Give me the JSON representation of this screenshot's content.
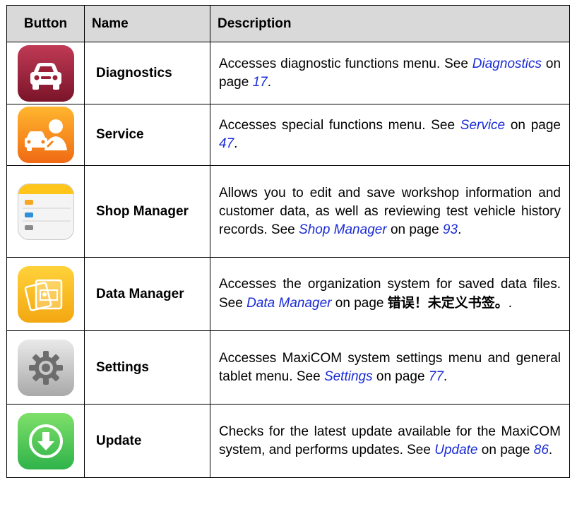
{
  "table": {
    "headers": [
      "Button",
      "Name",
      "Description"
    ],
    "rows": [
      {
        "name": "Diagnostics",
        "icon": "car-diagnostics-icon",
        "desc_pre": "Accesses diagnostic functions menu. See",
        "link": "Diagnostics",
        "mid": "on page",
        "page": "17",
        "post": "."
      },
      {
        "name": "Service",
        "icon": "car-service-icon",
        "desc_pre": "Accesses special functions menu. See",
        "link": "Service",
        "mid": "on page",
        "page": "47",
        "post": "."
      },
      {
        "name": "Shop Manager",
        "icon": "shop-manager-icon",
        "desc_pre": "Allows you to edit and save workshop information and customer data, as well as reviewing test vehicle history records. See",
        "link": "Shop Manager",
        "mid": "on page",
        "page": "93",
        "post": "."
      },
      {
        "name": "Data Manager",
        "icon": "data-manager-icon",
        "desc_pre": "Accesses the organization system for saved data files. See",
        "link": "Data Manager",
        "mid": "on page",
        "page": "错误！未定义书签。",
        "post": "."
      },
      {
        "name": "Settings",
        "icon": "gear-icon",
        "desc_pre": "Accesses MaxiCOM system settings menu and general tablet menu. See",
        "link": "Settings",
        "mid": "on page",
        "page": "77",
        "post": "."
      },
      {
        "name": "Update",
        "icon": "download-arrow-icon",
        "desc_pre": "Checks for the latest update available for the MaxiCOM system, and performs updates. See",
        "link": "Update",
        "mid": "on page",
        "page": "86",
        "post": "."
      }
    ]
  }
}
